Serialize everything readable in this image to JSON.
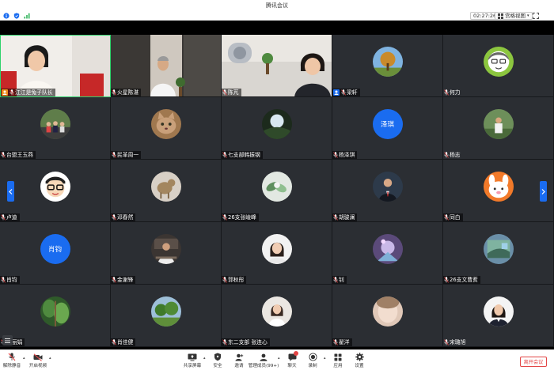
{
  "window": {
    "title": "腾讯会议"
  },
  "toolbar": {
    "timer": "02:27:26",
    "view_label": "宫格视图"
  },
  "tiles": [
    {
      "name": "江江是兔子队长",
      "kind": "video",
      "role": "host",
      "active": true
    },
    {
      "name": "火星陈湛",
      "kind": "video",
      "role": ""
    },
    {
      "name": "陈芃",
      "kind": "video",
      "role": ""
    },
    {
      "name": "梁轩",
      "kind": "avatar",
      "role": "cohost",
      "avatar": "tree-avatar-icon"
    },
    {
      "name": "何力",
      "kind": "avatar",
      "role": "",
      "plain": true,
      "avatar": "cartoon-girl-avatar-icon"
    },
    {
      "name": "台盟王玉燕",
      "kind": "avatar",
      "role": "",
      "avatar": "group-photo-avatar-icon"
    },
    {
      "name": "民革周一",
      "kind": "avatar",
      "role": "",
      "avatar": "cat-avatar-icon"
    },
    {
      "name": "七支部韩振钢",
      "kind": "avatar",
      "role": "",
      "avatar": "landscape-avatar-icon"
    },
    {
      "name": "杨泽琪",
      "kind": "avatar",
      "role": "",
      "text": "泽琪"
    },
    {
      "name": "杨志",
      "kind": "avatar",
      "role": "",
      "plain": true,
      "avatar": "person-outdoor-avatar-icon"
    },
    {
      "name": "卢迪",
      "kind": "avatar",
      "role": "",
      "avatar": "cartoon-glasses-avatar-icon"
    },
    {
      "name": "邓春然",
      "kind": "avatar",
      "role": "",
      "avatar": "animal-avatar-icon"
    },
    {
      "name": "26支张崚峰",
      "kind": "avatar",
      "role": "",
      "avatar": "flower-avatar-icon"
    },
    {
      "name": "胡骏澜",
      "kind": "avatar",
      "role": "",
      "avatar": "man-suit-avatar-icon"
    },
    {
      "name": "同白",
      "kind": "avatar",
      "role": "",
      "avatar": "cartoon-bunny-avatar-icon"
    },
    {
      "name": "肖钧",
      "kind": "avatar",
      "role": "",
      "text": "肖钧"
    },
    {
      "name": "金谢锋",
      "kind": "avatar",
      "role": "",
      "avatar": "man-office-avatar-icon"
    },
    {
      "name": "郭秋彤",
      "kind": "avatar",
      "role": "",
      "avatar": "woman-portrait-avatar-icon"
    },
    {
      "name": "钊",
      "kind": "avatar",
      "role": "",
      "avatar": "fantasy-avatar-icon"
    },
    {
      "name": "26支文曹荄",
      "kind": "avatar",
      "role": "",
      "avatar": "painting-avatar-icon"
    },
    {
      "name": "曹丽娟",
      "kind": "avatar",
      "role": "",
      "avatar": "green-plants-avatar-icon"
    },
    {
      "name": "肖佳健",
      "kind": "avatar",
      "role": "",
      "avatar": "trees-avatar-icon"
    },
    {
      "name": "东二支部 张连心",
      "kind": "avatar",
      "role": "",
      "avatar": "woman-white-avatar-icon"
    },
    {
      "name": "翟洋",
      "kind": "avatar",
      "role": "",
      "avatar": "blurry-face-avatar-icon"
    },
    {
      "name": "宋璐旭",
      "kind": "avatar",
      "role": "",
      "plain": true,
      "avatar": "woman-dark-avatar-icon"
    }
  ],
  "controls": {
    "mute": "解除静音",
    "video": "开启视频",
    "share": "共享屏幕",
    "security": "安全",
    "invite": "邀请",
    "members": "管理成员(99+)",
    "chat": "聊天",
    "record": "录制",
    "apps": "应用",
    "settings": "设置",
    "leave": "离开会议"
  },
  "colors": {
    "accent": "#1a6cf0",
    "active_speaker": "#2fd36c",
    "leave": "#e34545",
    "host_badge": "#f08c1a",
    "cohost_badge": "#1a6cf0"
  }
}
